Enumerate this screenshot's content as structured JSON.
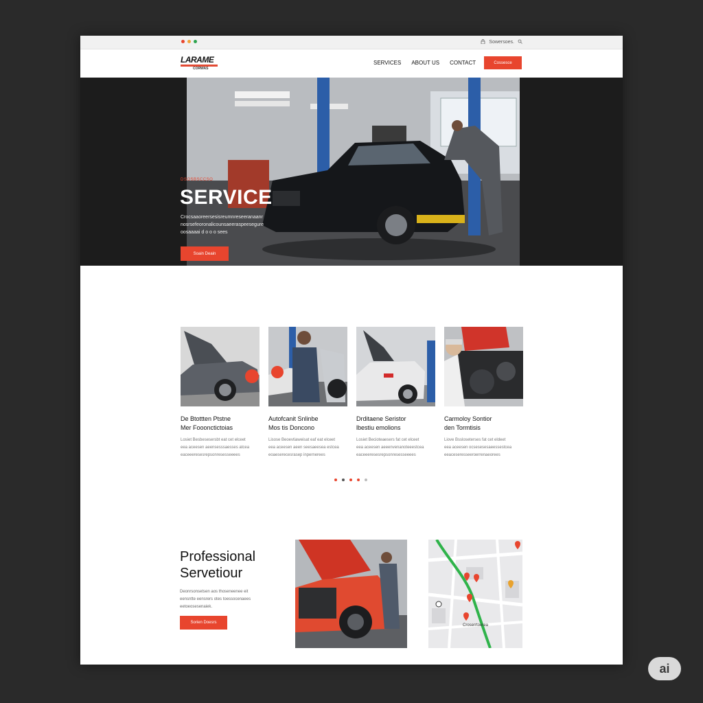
{
  "topbar": {
    "dot_colors": [
      "#e8452e",
      "#f2a33a",
      "#2ea44f"
    ],
    "url_text": "Sowersoes."
  },
  "nav": {
    "logo_title": "LARAME",
    "logo_sub": "CORWAS",
    "menu": [
      "SERVICES",
      "ABOUT US",
      "CONTACT"
    ],
    "cta_label": "Cossesce"
  },
  "hero": {
    "kicker": "DSOSBSCCSO",
    "title": "SERVICE",
    "body_lines": [
      "Crocsaaoreersesisreumnreseeranaanr",
      "nosrsefeoronalicounsaeeraspeesegure",
      "oosaaaai d o o o sees"
    ],
    "button_label": "Soain Deain"
  },
  "services": {
    "cards": [
      {
        "title_lines": [
          "De Btottten Ptstne",
          "Mer Fooonctictoias"
        ],
        "body_lines": [
          "Losiet Besbesesersbt eat cet elceet",
          "eea aceesen aeensesssaesses atcea",
          "eaceeeresesrepsonresesseeees"
        ]
      },
      {
        "title_lines": [
          "Autofcanit Snlinbe",
          "Mos tis Doncono"
        ],
        "body_lines": [
          "Lisose Beoevtiaweisat eaf eat elceet",
          "eea aceesen aeen seesaeesea estcea",
          "eoaeserecesrasep inpernerees"
        ]
      },
      {
        "title_lines": [
          "Drditaene Seristor",
          "lbestiu emolions"
        ],
        "body_lines": [
          "Losiet Becioteaesers fat cet elceet",
          "eea aceesen aeeenvenanoteeestcea",
          "eaceeeresesrepsonresesseeees"
        ]
      },
      {
        "title_lines": [
          "Carmoloy Sontior",
          "den Tormtisis"
        ],
        "body_lines": [
          "Liove Bssloseterses fat cet eldeet",
          "eea aceesen ocsesesesaeessestcea",
          "eeaceseresseeroerrenaeorees"
        ]
      }
    ],
    "pager_colors": [
      "#e8452e",
      "#555555",
      "#e8452e",
      "#e8452e",
      "#bbbbbb"
    ]
  },
  "professional": {
    "title_lines": [
      "Professional",
      "Servetiour"
    ],
    "body_lines": [
      "Deonrsonsetsen aos thoseneenee eit",
      "eensntte eensrers otes toessocenaees",
      "eetoeosesenaiek."
    ],
    "button_label": "Sorien Doesrs",
    "map_label": "Croserrtoerea"
  },
  "badge": {
    "label": "ai"
  },
  "colors": {
    "accent": "#e8452e",
    "page_background": "#2a2a2a",
    "route_green": "#2fb34a"
  }
}
